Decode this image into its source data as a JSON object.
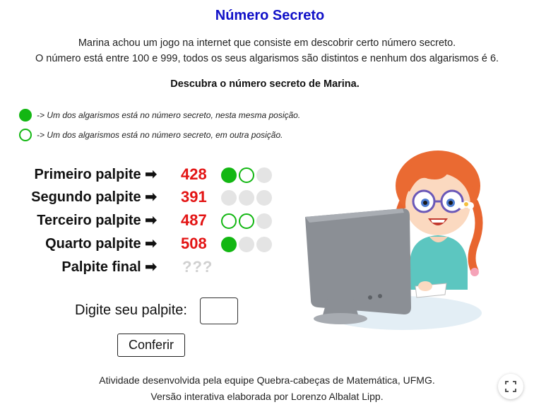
{
  "title": "Número Secreto",
  "intro": {
    "line1": "Marina achou um jogo na internet que consiste em descobrir certo número secreto.",
    "line2": "O número está entre 100 e 999, todos os seus algarismos são distintos e nenhum dos algarismos é 6."
  },
  "challenge": "Descubra o número secreto de Marina.",
  "legend": [
    {
      "marker": "filled",
      "text": "-> Um dos algarismos está no número secreto, nesta mesma posição."
    },
    {
      "marker": "ring",
      "text": "-> Um dos algarismos está no número secreto, em outra posição."
    }
  ],
  "arrow": "➡",
  "guesses": [
    {
      "label": "Primeiro palpite",
      "number": "428",
      "markers": [
        "filled",
        "ring",
        "gray"
      ]
    },
    {
      "label": "Segundo palpite",
      "number": "391",
      "markers": [
        "gray",
        "gray",
        "gray"
      ]
    },
    {
      "label": "Terceiro palpite",
      "number": "487",
      "markers": [
        "ring",
        "ring",
        "gray"
      ]
    },
    {
      "label": "Quarto palpite",
      "number": "508",
      "markers": [
        "filled",
        "gray",
        "gray"
      ]
    }
  ],
  "final_guess": {
    "label": "Palpite final",
    "number": "???"
  },
  "input": {
    "label": "Digite seu palpite:",
    "value": ""
  },
  "button": {
    "label": "Conferir"
  },
  "footer": {
    "line1": "Atividade desenvolvida pela equipe Quebra-cabeças de Matemática, UFMG.",
    "line2": "Versão interativa elaborada por Lorenzo Albalat Lipp."
  },
  "colors": {
    "title": "#1010c8",
    "number": "#e31414",
    "marker_green": "#13b713",
    "marker_gray": "#e4e4e4"
  },
  "icons": {
    "fullscreen": "fullscreen-icon",
    "illustration": "girl-at-computer-illustration"
  }
}
